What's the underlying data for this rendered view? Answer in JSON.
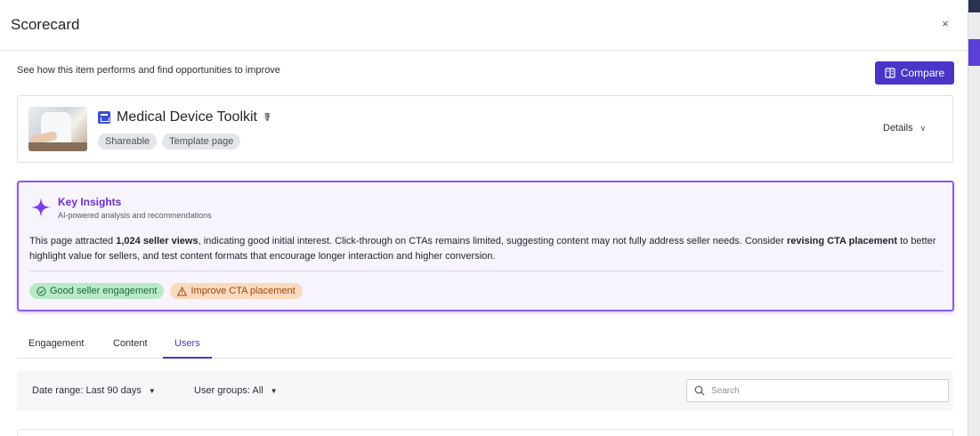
{
  "modal": {
    "title": "Scorecard",
    "close_label": "×",
    "subtitle": "See how this item performs and find opportunities to improve",
    "compare_label": "Compare"
  },
  "item": {
    "title": "Medical Device Toolkit",
    "tags": [
      "Shareable",
      "Template page"
    ],
    "details_label": "Details"
  },
  "insights": {
    "title": "Key Insights",
    "subtitle": "AI-powered analysis and recommendations",
    "body_parts": [
      "This page attracted ",
      "1,024 seller views",
      ", indicating good initial interest. Click-through on CTAs remains limited, suggesting content may not fully address seller needs. Consider ",
      "revising CTA placement",
      " to better highlight value for sellers, and test content formats that encourage longer interaction and higher conversion."
    ],
    "badges": [
      {
        "label": "Good seller engagement",
        "type": "good",
        "icon": "check-circle-icon"
      },
      {
        "label": "Improve CTA placement",
        "type": "warn",
        "icon": "warning-icon"
      }
    ],
    "accent_color": "#8b5cf0"
  },
  "tabs": [
    {
      "label": "Engagement",
      "active": false
    },
    {
      "label": "Content",
      "active": false
    },
    {
      "label": "Users",
      "active": true
    }
  ],
  "filters": {
    "date_range": "Date range: Last 90 days",
    "user_groups": "User groups: All",
    "search_placeholder": "Search"
  },
  "colors": {
    "primary": "#4a35c9",
    "good": "#b8eac7",
    "warn": "#fbd9bd"
  }
}
